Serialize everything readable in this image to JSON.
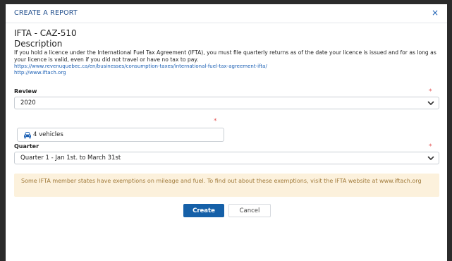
{
  "header": {
    "title": "CREATE A REPORT",
    "close_label": "×"
  },
  "form": {
    "title": "IFTA - CAZ-510",
    "description_heading": "Description",
    "description_text": "If you hold a licence under the International Fuel Tax Agreement (IFTA), you must file quarterly returns as of the date your licence is issued and for as long as your licence is valid, even if you did not travel or have no tax to pay.",
    "links": [
      "https://www.revenuquebec.ca/en/businesses/consumption-taxes/international-fuel-tax-agreement-ifta/",
      "http://www.iftach.org"
    ],
    "review": {
      "label": "Review",
      "value": "2020"
    },
    "vehicles": {
      "value": "4 vehicles"
    },
    "quarter": {
      "label": "Quarter",
      "value": "Quarter 1 - Jan 1st. to March 31st"
    },
    "required_mark": "*",
    "alert": "Some IFTA member states have exemptions on mileage and fuel. To find out about these exemptions, visit the IFTA website at www.iftach.org",
    "buttons": {
      "create": "Create",
      "cancel": "Cancel"
    }
  },
  "colors": {
    "accent": "#1560a8",
    "link": "#1a5fb4",
    "required": "#e45454",
    "alert_bg": "#fcf1dc",
    "alert_text": "#a07a3a"
  },
  "icons": {
    "close": "close-icon",
    "vehicle": "car-icon",
    "dropdown": "chevron-down-icon"
  }
}
